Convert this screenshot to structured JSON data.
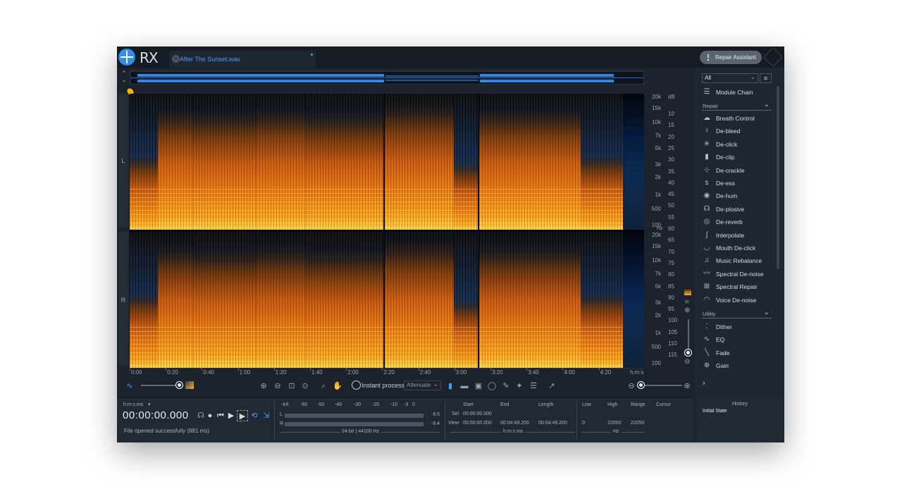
{
  "app": {
    "logo_text": "RX",
    "logo_icon": "izotope-rx-logo",
    "brand_icon": "izotope-corner-logo"
  },
  "tab": {
    "title": "After The Sunset.wav",
    "close_icon": "close-circle-icon"
  },
  "header": {
    "assistant_button": "Repair Assistant"
  },
  "channels": {
    "left": "L",
    "right": "R"
  },
  "hz_scale": [
    "20k",
    "15k",
    "10k",
    "7k",
    "5k",
    "3k",
    "2k",
    "1k",
    "500",
    "100"
  ],
  "hz_unit": "Hz",
  "db_scale": {
    "title": "dB",
    "values": [
      "10",
      "15",
      "20",
      "25",
      "30",
      "35",
      "40",
      "45",
      "50",
      "55",
      "60",
      "65",
      "70",
      "75",
      "80",
      "85",
      "90",
      "95",
      "100",
      "105",
      "110",
      "115"
    ]
  },
  "time_scale": {
    "labels": [
      "0:00",
      "0:20",
      "0:40",
      "1:00",
      "1:20",
      "1:40",
      "2:00",
      "2:20",
      "2:40",
      "3:00",
      "3:20",
      "3:40",
      "4:00",
      "4:20"
    ],
    "unit": "h:m:s"
  },
  "toolbar": {
    "instant_process": "Instant process",
    "attenuate": "Attenuate"
  },
  "transport": {
    "format_label": "h:m:s.ms",
    "timecode": "00:00:00.000",
    "status": "File opened successfully (881 ms)"
  },
  "meters": {
    "scale": [
      "-Inf.",
      "-60",
      "-50",
      "-40",
      "-30",
      "-20",
      "-10",
      "-3",
      "0"
    ],
    "left_label": "L",
    "right_label": "R",
    "left_peak": "-9.5",
    "right_peak": "-9.4",
    "format": "24-bit | 44100 Hz"
  },
  "selection": {
    "start_hdr": "Start",
    "end_hdr": "End",
    "length_hdr": "Length",
    "sel_label": "Sel",
    "view_label": "View",
    "sel_start": "00:00:00.000",
    "view_start": "00:00:00.000",
    "view_end": "00:04:49.200",
    "view_length": "00:04:49.200",
    "unit": "h:m:s.ms"
  },
  "freq": {
    "low_hdr": "Low",
    "high_hdr": "High",
    "range_hdr": "Range",
    "cursor_hdr": "Cursor",
    "low": "0",
    "high": "22050",
    "range": "22050",
    "unit": "Hz"
  },
  "modules": {
    "filter": "All",
    "module_chain": "Module Chain",
    "repair_header": "Repair",
    "repair": [
      {
        "label": "Breath Control",
        "icon": "breath-control-icon",
        "glyph": "☁"
      },
      {
        "label": "De-bleed",
        "icon": "microphone-icon",
        "glyph": "♀"
      },
      {
        "label": "De-click",
        "icon": "click-burst-icon",
        "glyph": "✳"
      },
      {
        "label": "De-clip",
        "icon": "clip-icon",
        "glyph": "▮"
      },
      {
        "label": "De-crackle",
        "icon": "crackle-icon",
        "glyph": "⊹"
      },
      {
        "label": "De-ess",
        "icon": "de-ess-icon",
        "glyph": "ꜱ"
      },
      {
        "label": "De-hum",
        "icon": "hum-icon",
        "glyph": "◉"
      },
      {
        "label": "De-plosive",
        "icon": "plosive-icon",
        "glyph": "☊"
      },
      {
        "label": "De-reverb",
        "icon": "reverb-icon",
        "glyph": "◎"
      },
      {
        "label": "Interpolate",
        "icon": "interpolate-icon",
        "glyph": "∫"
      },
      {
        "label": "Mouth De-click",
        "icon": "mouth-icon",
        "glyph": "◡"
      },
      {
        "label": "Music Rebalance",
        "icon": "music-note-icon",
        "glyph": "♫"
      },
      {
        "label": "Spectral De-noise",
        "icon": "spectral-wave-icon",
        "glyph": "〰"
      },
      {
        "label": "Spectral Repair",
        "icon": "spectral-repair-icon",
        "glyph": "⊞"
      },
      {
        "label": "Voice De-noise",
        "icon": "lips-icon",
        "glyph": "◠"
      }
    ],
    "utility_header": "Utility",
    "utility": [
      {
        "label": "Dither",
        "icon": "dither-icon",
        "glyph": "⁚"
      },
      {
        "label": "EQ",
        "icon": "eq-curve-icon",
        "glyph": "∿"
      },
      {
        "label": "Fade",
        "icon": "fade-icon",
        "glyph": "╲"
      },
      {
        "label": "Gain",
        "icon": "gain-icon",
        "glyph": "⊕"
      }
    ],
    "expand_icon": "chevron-right-icon"
  },
  "history": {
    "title": "History",
    "item": "Initial State"
  },
  "colors": {
    "accent": "#2f8ee8",
    "spectrogram_hot": "#ffa21a",
    "background": "#1c232c"
  }
}
